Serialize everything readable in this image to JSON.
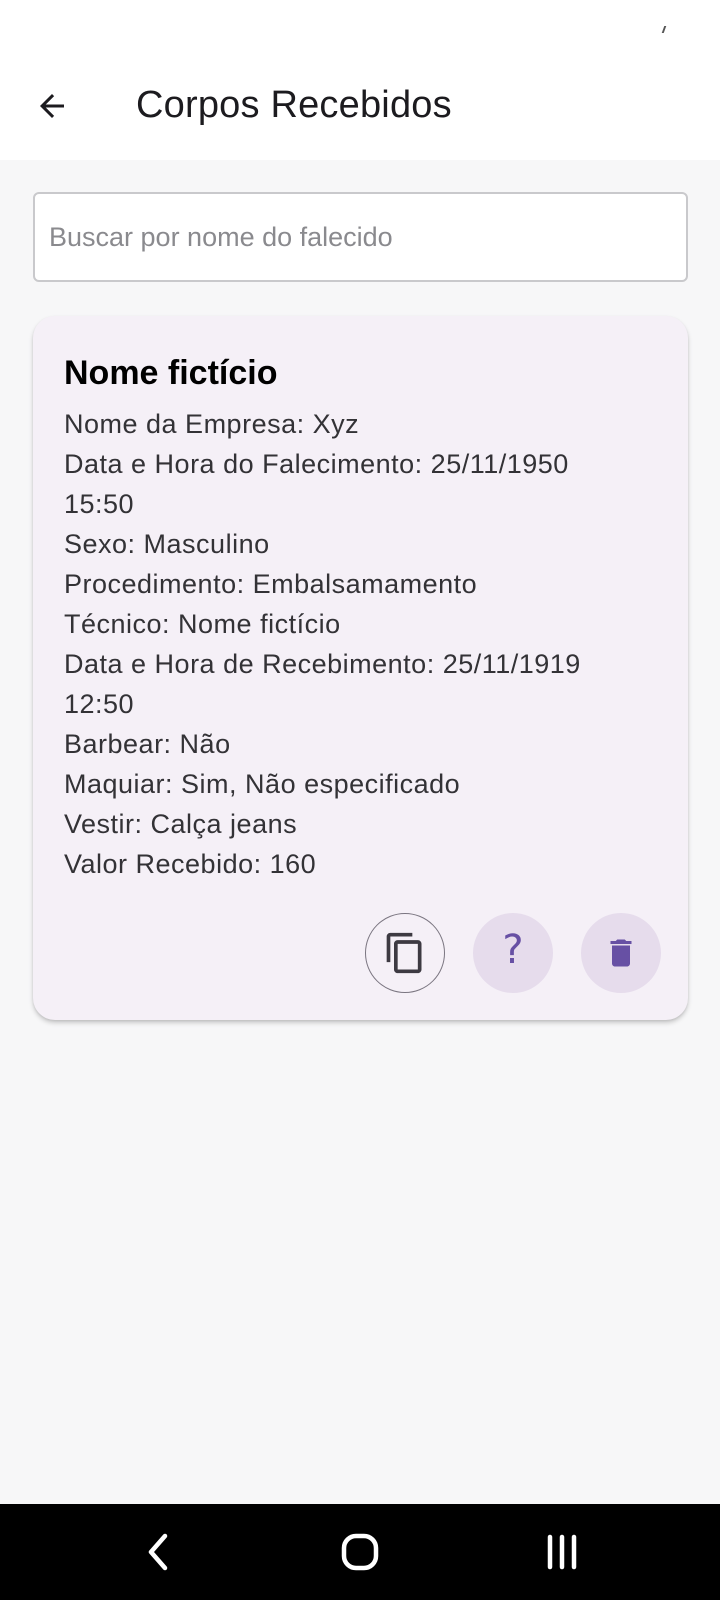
{
  "header": {
    "title": "Corpos Recebidos",
    "back_icon": "arrow-back-icon"
  },
  "search": {
    "placeholder": "Buscar por nome do falecido",
    "value": ""
  },
  "record": {
    "title": "Nome fictício",
    "fields": [
      "Nome da Empresa: Xyz",
      "Data e Hora do Falecimento: 25/11/1950",
      "15:50",
      "Sexo: Masculino",
      "Procedimento: Embalsamamento",
      "Técnico: Nome fictício",
      "Data e Hora de Recebimento: 25/11/1919",
      "12:50",
      "Barbear: Não",
      "Maquiar: Sim, Não especificado",
      "Vestir: Calça jeans",
      "Valor Recebido: 160"
    ],
    "actions": {
      "copy_icon": "copy-icon",
      "help_icon": "help-icon",
      "help_glyph": "?",
      "delete_icon": "delete-icon"
    }
  },
  "system_nav": {
    "back_icon": "nav-back-icon",
    "home_icon": "nav-home-icon",
    "recents_icon": "nav-recents-icon"
  },
  "colors": {
    "accent": "#6750a4",
    "card_background": "#f5f0f7",
    "tonal_button": "#e6dcec",
    "page_background": "#f7f7f8"
  }
}
